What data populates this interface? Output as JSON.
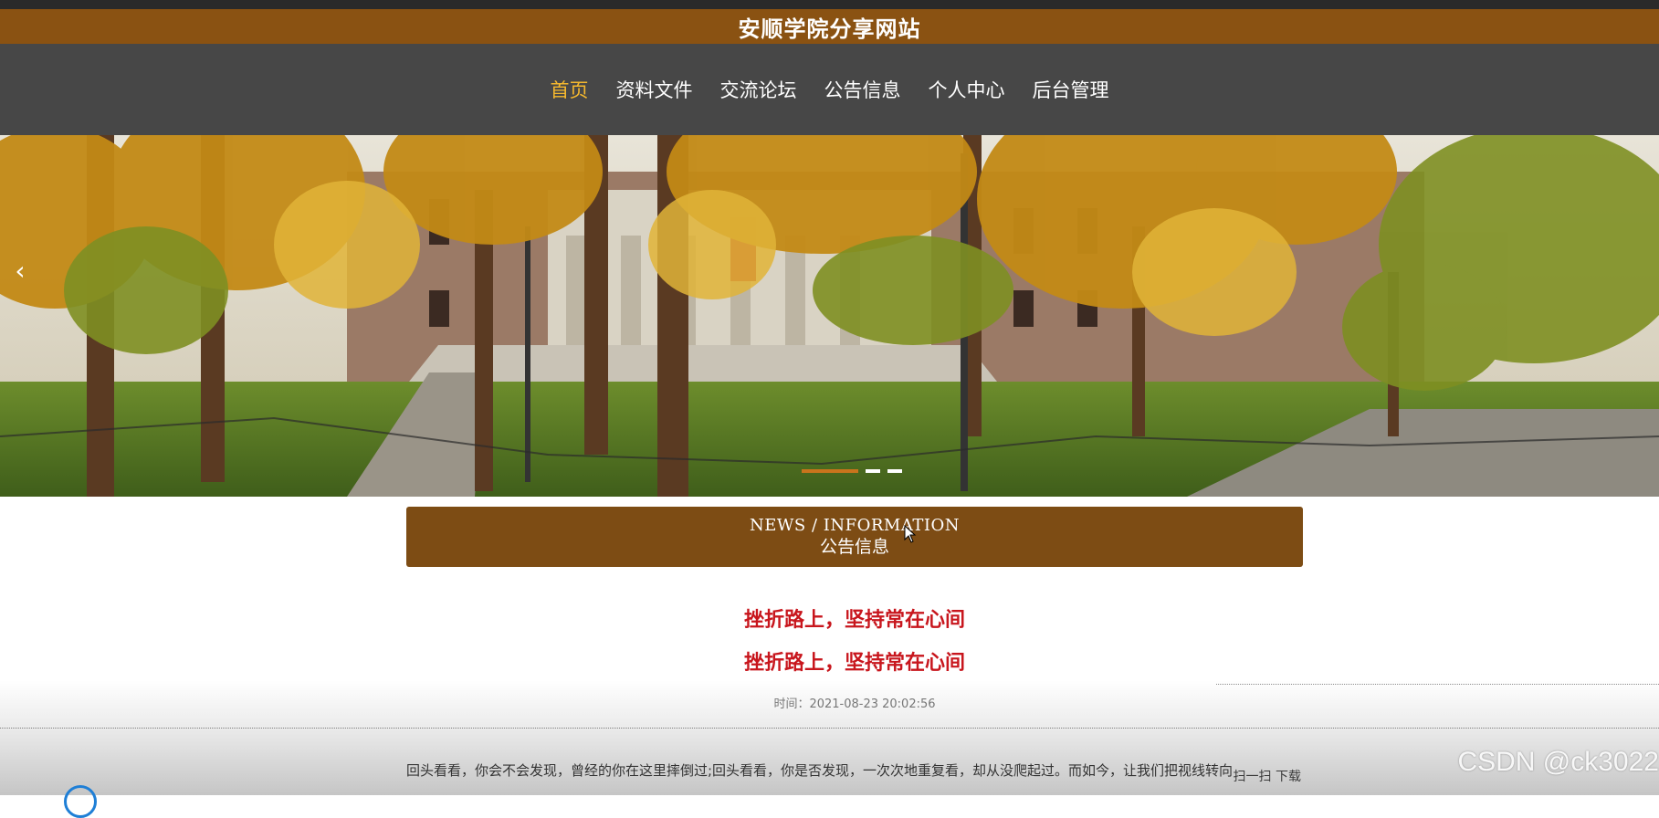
{
  "site": {
    "title": "安顺学院分享网站"
  },
  "nav": {
    "items": [
      {
        "label": "首页",
        "active": true
      },
      {
        "label": "资料文件",
        "active": false
      },
      {
        "label": "交流论坛",
        "active": false
      },
      {
        "label": "公告信息",
        "active": false
      },
      {
        "label": "个人中心",
        "active": false
      },
      {
        "label": "后台管理",
        "active": false
      }
    ]
  },
  "banner": {
    "prev_icon": "chevron-left-icon",
    "prev_glyph": "‹",
    "slide_count": 3,
    "active_slide": 1
  },
  "section": {
    "title_en": "NEWS / INFORMATION",
    "title_zh": "公告信息"
  },
  "article": {
    "title_1": "挫折路上，坚持常在心间",
    "title_2": "挫折路上，坚持常在心间",
    "time": "时间：2021-08-23 20:02:56",
    "body": "回头看看，你会不会发现，曾经的你在这里摔倒过;回头看看，你是否发现，一次次地重复看，却从没爬起过。而如今，让我们把视线转向"
  },
  "side": {
    "text": "扫一扫 下载"
  },
  "watermark": {
    "text": "CSDN @ck3022"
  },
  "colors": {
    "header_bg": "#8a5212",
    "nav_bg": "#474747",
    "nav_active": "#f5b82e",
    "section_bg": "#7d4c14",
    "title_red": "#c8161d"
  }
}
